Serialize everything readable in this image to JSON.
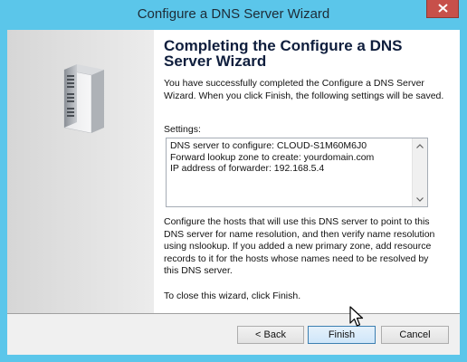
{
  "window": {
    "title": "Configure a DNS Server Wizard"
  },
  "page": {
    "heading_line1": "Completing the Configure a DNS",
    "heading_line2": "Server Wizard",
    "intro": "You have successfully completed the Configure a DNS Server Wizard. When you click Finish, the following settings will be saved.",
    "settings_label": "Settings:",
    "settings": [
      "DNS server to configure: CLOUD-S1M60M6J0",
      "Forward lookup zone to create: yourdomain.com",
      "IP address of forwarder: 192.168.5.4"
    ],
    "description": "Configure the hosts that will use this DNS server to point to this DNS server for name resolution, and then verify name resolution using nslookup. If you added a new primary zone, add resource records to it for the hosts whose names need to be resolved by this DNS server.",
    "close_hint": "To close this wizard, click Finish."
  },
  "buttons": {
    "back": "< Back",
    "finish": "Finish",
    "cancel": "Cancel"
  },
  "icons": {
    "close": "close-icon",
    "server": "server-icon",
    "scroll_up": "scroll-up-arrow-icon",
    "scroll_down": "scroll-down-arrow-icon",
    "cursor": "mouse-pointer-icon"
  },
  "colors": {
    "titlebar": "#5bc6ea",
    "close_button": "#c7504a",
    "heading": "#0f1e3d",
    "finish_border": "#3c7fb1"
  }
}
